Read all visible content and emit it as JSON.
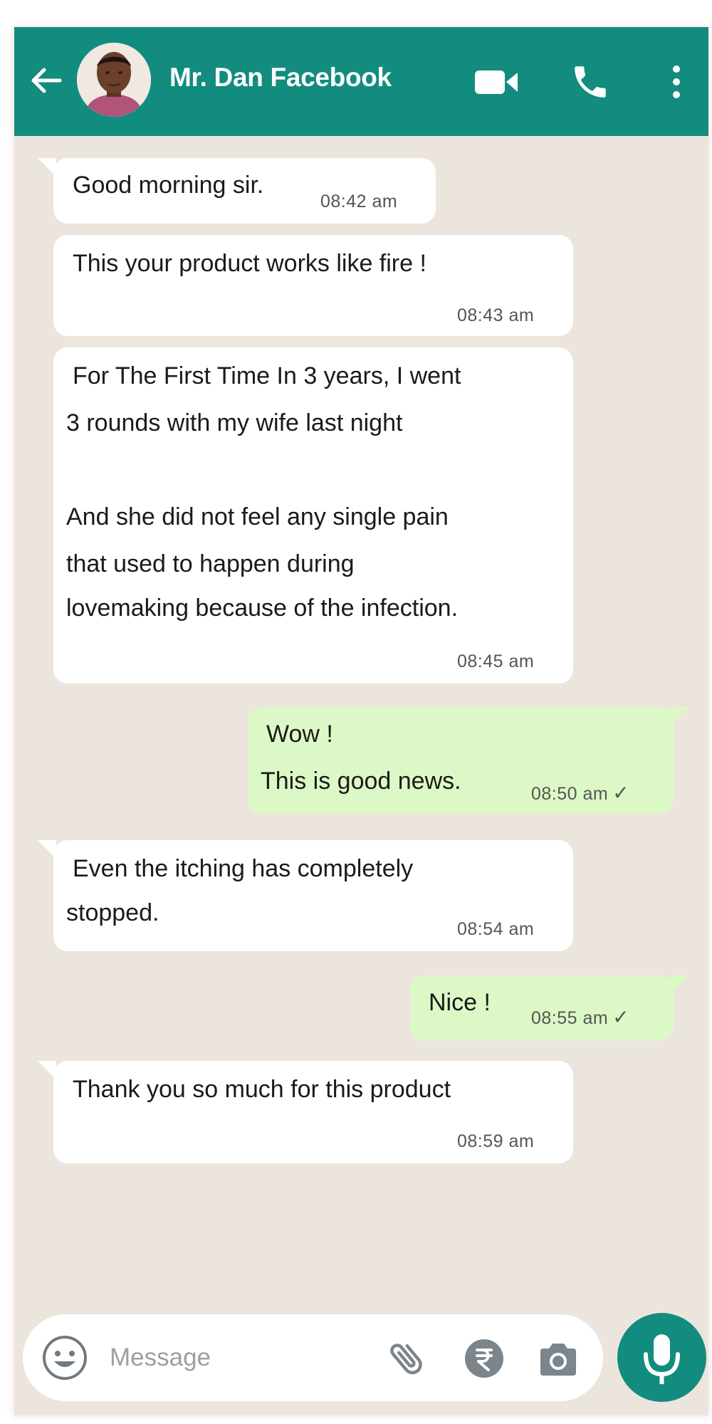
{
  "header": {
    "contact_name": "Mr. Dan Facebook",
    "background_color": "#128c7e",
    "icons": [
      "back-arrow-icon",
      "avatar",
      "video-call-icon",
      "phone-call-icon",
      "more-vertical-icon"
    ]
  },
  "messages": [
    {
      "direction": "incoming",
      "text_lines": [
        "Good morning sir."
      ],
      "time": "08:42 am"
    },
    {
      "direction": "incoming",
      "text_lines": [
        "This your product works  like fire !"
      ],
      "time": "08:43 am"
    },
    {
      "direction": "incoming",
      "text_lines": [
        "For The First Time In 3 years, I went",
        "3 rounds with my wife last night",
        "",
        "And she did not feel any single pain",
        "that used to happen during",
        "lovemaking because of the infection."
      ],
      "time": "08:45 am"
    },
    {
      "direction": "outgoing",
      "text_lines": [
        "Wow !",
        "This is good news."
      ],
      "time": "08:50 am",
      "status": "sent"
    },
    {
      "direction": "incoming",
      "text_lines": [
        "Even the itching has completely",
        "stopped."
      ],
      "time": "08:54 am"
    },
    {
      "direction": "outgoing",
      "text_lines": [
        "Nice !"
      ],
      "time": "08:55 am",
      "status": "sent"
    },
    {
      "direction": "incoming",
      "text_lines": [
        "Thank you so much for this product"
      ],
      "time": "08:59 am"
    }
  ],
  "input_bar": {
    "placeholder": "Message",
    "icons": [
      "emoji-icon",
      "attach-icon",
      "rupee-payment-icon",
      "camera-icon",
      "mic-icon"
    ]
  },
  "colors": {
    "header": "#128c7e",
    "chat_background": "#ece5dd",
    "incoming_bubble": "#ffffff",
    "outgoing_bubble": "#dcf8c6",
    "mic_button": "#128c7e"
  }
}
